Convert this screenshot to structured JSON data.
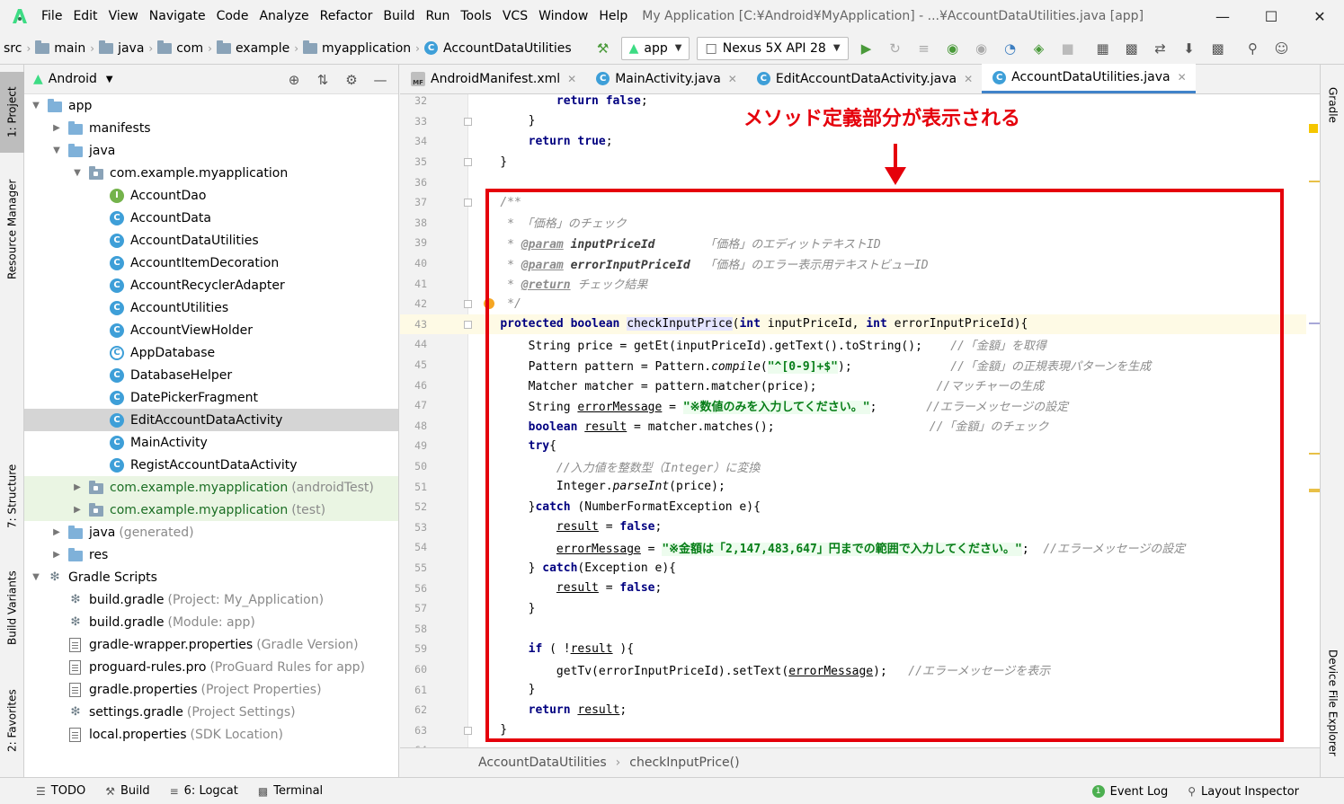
{
  "menu": {
    "items": [
      "File",
      "Edit",
      "View",
      "Navigate",
      "Code",
      "Analyze",
      "Refactor",
      "Build",
      "Run",
      "Tools",
      "VCS",
      "Window",
      "Help"
    ],
    "title": "My Application [C:¥Android¥MyApplication] - ...¥AccountDataUtilities.java [app]"
  },
  "navbar": {
    "crumbs": [
      "src",
      "main",
      "java",
      "com",
      "example",
      "myapplication"
    ],
    "current_class": "AccountDataUtilities",
    "run_config": "app",
    "device": "Nexus 5X API 28"
  },
  "left_stripe": {
    "project": "1: Project",
    "resource_manager": "Resource Manager",
    "structure": "7: Structure",
    "build_variants": "Build Variants",
    "favorites": "2: Favorites"
  },
  "right_stripe": {
    "gradle": "Gradle",
    "device_file_explorer": "Device File Explorer"
  },
  "project_panel": {
    "view_mode": "Android",
    "tree": [
      {
        "label": "app",
        "suffix": "",
        "type": "module",
        "depth": 0,
        "arrow": "open"
      },
      {
        "label": "manifests",
        "suffix": "",
        "type": "folder",
        "depth": 1,
        "arrow": "closed"
      },
      {
        "label": "java",
        "suffix": "",
        "type": "folder",
        "depth": 1,
        "arrow": "open"
      },
      {
        "label": "com.example.myapplication",
        "suffix": "",
        "type": "package",
        "depth": 2,
        "arrow": "open"
      },
      {
        "label": "AccountDao",
        "suffix": "",
        "type": "interface",
        "depth": 3,
        "arrow": "none"
      },
      {
        "label": "AccountData",
        "suffix": "",
        "type": "class",
        "depth": 3,
        "arrow": "none"
      },
      {
        "label": "AccountDataUtilities",
        "suffix": "",
        "type": "class",
        "depth": 3,
        "arrow": "none"
      },
      {
        "label": "AccountItemDecoration",
        "suffix": "",
        "type": "class",
        "depth": 3,
        "arrow": "none"
      },
      {
        "label": "AccountRecyclerAdapter",
        "suffix": "",
        "type": "class",
        "depth": 3,
        "arrow": "none"
      },
      {
        "label": "AccountUtilities",
        "suffix": "",
        "type": "class",
        "depth": 3,
        "arrow": "none"
      },
      {
        "label": "AccountViewHolder",
        "suffix": "",
        "type": "class",
        "depth": 3,
        "arrow": "none"
      },
      {
        "label": "AppDatabase",
        "suffix": "",
        "type": "abstract",
        "depth": 3,
        "arrow": "none"
      },
      {
        "label": "DatabaseHelper",
        "suffix": "",
        "type": "class",
        "depth": 3,
        "arrow": "none"
      },
      {
        "label": "DatePickerFragment",
        "suffix": "",
        "type": "class",
        "depth": 3,
        "arrow": "none"
      },
      {
        "label": "EditAccountDataActivity",
        "suffix": "",
        "type": "class",
        "depth": 3,
        "arrow": "none",
        "selected": true
      },
      {
        "label": "MainActivity",
        "suffix": "",
        "type": "class",
        "depth": 3,
        "arrow": "none"
      },
      {
        "label": "RegistAccountDataActivity",
        "suffix": "",
        "type": "class",
        "depth": 3,
        "arrow": "none"
      },
      {
        "label": "com.example.myapplication",
        "suffix": "(androidTest)",
        "type": "package",
        "depth": 2,
        "arrow": "closed",
        "test": true
      },
      {
        "label": "com.example.myapplication",
        "suffix": "(test)",
        "type": "package",
        "depth": 2,
        "arrow": "closed",
        "test": true
      },
      {
        "label": "java",
        "suffix": "(generated)",
        "type": "genfolder",
        "depth": 1,
        "arrow": "closed"
      },
      {
        "label": "res",
        "suffix": "",
        "type": "resfolder",
        "depth": 1,
        "arrow": "closed"
      },
      {
        "label": "Gradle Scripts",
        "suffix": "",
        "type": "gradleroot",
        "depth": 0,
        "arrow": "open"
      },
      {
        "label": "build.gradle",
        "suffix": "(Project: My_Application)",
        "type": "gradle",
        "depth": 1,
        "arrow": "none"
      },
      {
        "label": "build.gradle",
        "suffix": "(Module: app)",
        "type": "gradle",
        "depth": 1,
        "arrow": "none"
      },
      {
        "label": "gradle-wrapper.properties",
        "suffix": "(Gradle Version)",
        "type": "props",
        "depth": 1,
        "arrow": "none"
      },
      {
        "label": "proguard-rules.pro",
        "suffix": "(ProGuard Rules for app)",
        "type": "file",
        "depth": 1,
        "arrow": "none"
      },
      {
        "label": "gradle.properties",
        "suffix": "(Project Properties)",
        "type": "props",
        "depth": 1,
        "arrow": "none"
      },
      {
        "label": "settings.gradle",
        "suffix": "(Project Settings)",
        "type": "gradle",
        "depth": 1,
        "arrow": "none"
      },
      {
        "label": "local.properties",
        "suffix": "(SDK Location)",
        "type": "props",
        "depth": 1,
        "arrow": "none"
      }
    ]
  },
  "editor": {
    "tabs": [
      {
        "label": "AndroidManifest.xml",
        "icon": "manifest-icon",
        "active": false
      },
      {
        "label": "MainActivity.java",
        "icon": "class-icon",
        "active": false
      },
      {
        "label": "EditAccountDataActivity.java",
        "icon": "class-icon",
        "active": false
      },
      {
        "label": "AccountDataUtilities.java",
        "icon": "class-icon",
        "active": true
      }
    ],
    "current_line": 43,
    "lines": [
      {
        "n": 32,
        "html": "            <span class=\"kw\">return false</span>;"
      },
      {
        "n": 33,
        "html": "        }"
      },
      {
        "n": 34,
        "html": "        <span class=\"kw\">return true</span>;"
      },
      {
        "n": 35,
        "html": "    }"
      },
      {
        "n": 36,
        "html": ""
      },
      {
        "n": 37,
        "html": "    <span class=\"cm\">/**</span>"
      },
      {
        "n": 38,
        "html": "<span class=\"cm\">     * 「価格」のチェック</span>"
      },
      {
        "n": 39,
        "html": "<span class=\"cm\">     * </span><span class=\"doctag\">@param</span> <span class=\"docname\">inputPriceId</span><span class=\"cm\">       「価格」のエディットテキストID</span>"
      },
      {
        "n": 40,
        "html": "<span class=\"cm\">     * </span><span class=\"doctag\">@param</span> <span class=\"docname\">errorInputPriceId</span><span class=\"cm\">  「価格」のエラー表示用テキストビューID</span>"
      },
      {
        "n": 41,
        "html": "<span class=\"cm\">     * </span><span class=\"doctag\">@return</span><span class=\"cm\"> チェック結果</span>"
      },
      {
        "n": 42,
        "html": "<span class=\"cm\">     */</span>"
      },
      {
        "n": 43,
        "html": "    <span class=\"kw\">protected boolean</span> <span class=\"mhl\">checkInputPrice</span>(<span class=\"kw\">int</span> inputPriceId, <span class=\"kw\">int</span> errorInputPriceId){"
      },
      {
        "n": 44,
        "html": "        String price = getEt(inputPriceId).getText().toString();    <span class=\"cm\">//「金額」を取得</span>"
      },
      {
        "n": 45,
        "html": "        Pattern pattern = Pattern.<span class=\"it\">compile</span>(<span class=\"str\">\"^[0-9]+$\"</span>);              <span class=\"cm\">//「金額」の正規表現パターンを生成</span>"
      },
      {
        "n": 46,
        "html": "        Matcher matcher = pattern.matcher(price);                 <span class=\"cm\">//マッチャーの生成</span>"
      },
      {
        "n": 47,
        "html": "        String <span class=\"ul\">errorMessage</span> = <span class=\"str\">\"※数値のみを入力してください。\"</span>;       <span class=\"cm\">//エラーメッセージの設定</span>"
      },
      {
        "n": 48,
        "html": "        <span class=\"kw\">boolean</span> <span class=\"ul\">result</span> = matcher.matches();                      <span class=\"cm\">//「金額」のチェック</span>"
      },
      {
        "n": 49,
        "html": "        <span class=\"kw\">try</span>{"
      },
      {
        "n": 50,
        "html": "            <span class=\"cm\">//入力値を整数型（Integer）に変換</span>"
      },
      {
        "n": 51,
        "html": "            Integer.<span class=\"it\">parseInt</span>(price);"
      },
      {
        "n": 52,
        "html": "        }<span class=\"kw\">catch</span> (NumberFormatException e){"
      },
      {
        "n": 53,
        "html": "            <span class=\"ul\">result</span> = <span class=\"kw\">false</span>;"
      },
      {
        "n": 54,
        "html": "            <span class=\"ul\">errorMessage</span> = <span class=\"str\">\"※金額は「2,147,483,647」円までの範囲で入力してください。\"</span>;  <span class=\"cm\">//エラーメッセージの設定</span>"
      },
      {
        "n": 55,
        "html": "        } <span class=\"kw\">catch</span>(Exception e){"
      },
      {
        "n": 56,
        "html": "            <span class=\"ul\">result</span> = <span class=\"kw\">false</span>;"
      },
      {
        "n": 57,
        "html": "        }"
      },
      {
        "n": 58,
        "html": ""
      },
      {
        "n": 59,
        "html": "        <span class=\"kw\">if</span> ( !<span class=\"ul\">result</span> ){"
      },
      {
        "n": 60,
        "html": "            getTv(errorInputPriceId).setText(<span class=\"ul\">errorMessage</span>);   <span class=\"cm\">//エラーメッセージを表示</span>"
      },
      {
        "n": 61,
        "html": "        }"
      },
      {
        "n": 62,
        "html": "        <span class=\"kw\">return</span> <span class=\"ul\">result</span>;"
      },
      {
        "n": 63,
        "html": "    }"
      },
      {
        "n": 64,
        "html": ""
      }
    ],
    "breadcrumb": [
      "AccountDataUtilities",
      "checkInputPrice()"
    ]
  },
  "annotation": {
    "text": "メソッド定義部分が表示される",
    "color": "#e5000b"
  },
  "statusbar": {
    "todo": "TODO",
    "build": "Build",
    "logcat": "6: Logcat",
    "terminal": "Terminal",
    "event_log": "Event Log",
    "event_count": "1",
    "layout_inspector": "Layout Inspector"
  }
}
